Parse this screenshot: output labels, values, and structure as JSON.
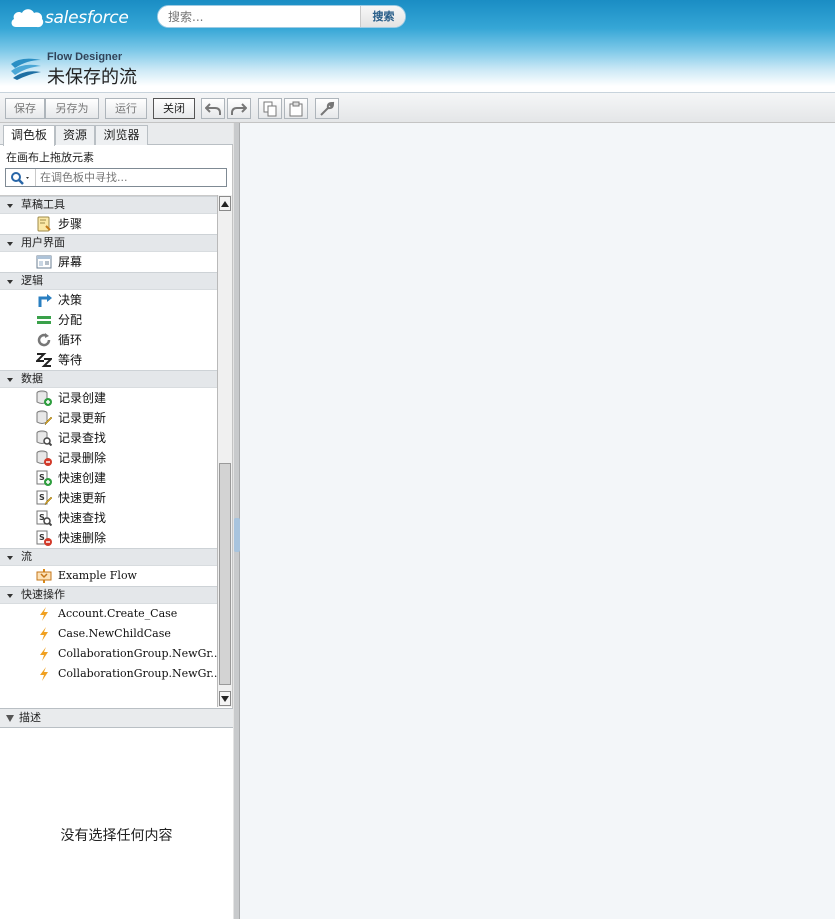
{
  "header": {
    "brand": "salesforce",
    "search_placeholder": "搜索...",
    "search_button": "搜索",
    "app_subtitle": "Flow Designer",
    "app_title": "未保存的流"
  },
  "toolbar": {
    "save": "保存",
    "save_as": "另存为",
    "run": "运行",
    "close": "关闭"
  },
  "left_panel": {
    "tabs": [
      "调色板",
      "资源",
      "浏览器"
    ],
    "hint": "在画布上拖放元素",
    "search_placeholder": "在调色板中寻找...",
    "sections": [
      {
        "title": "草稿工具",
        "items": [
          {
            "label": "步骤",
            "icon": "step-icon"
          }
        ]
      },
      {
        "title": "用户界面",
        "items": [
          {
            "label": "屏幕",
            "icon": "screen-icon"
          }
        ]
      },
      {
        "title": "逻辑",
        "items": [
          {
            "label": "决策",
            "icon": "decision-icon"
          },
          {
            "label": "分配",
            "icon": "assignment-icon"
          },
          {
            "label": "循环",
            "icon": "loop-icon"
          },
          {
            "label": "等待",
            "icon": "wait-icon"
          }
        ]
      },
      {
        "title": "数据",
        "items": [
          {
            "label": "记录创建",
            "icon": "record-create-icon"
          },
          {
            "label": "记录更新",
            "icon": "record-update-icon"
          },
          {
            "label": "记录查找",
            "icon": "record-lookup-icon"
          },
          {
            "label": "记录删除",
            "icon": "record-delete-icon"
          },
          {
            "label": "快速创建",
            "icon": "fast-create-icon"
          },
          {
            "label": "快速更新",
            "icon": "fast-update-icon"
          },
          {
            "label": "快速查找",
            "icon": "fast-lookup-icon"
          },
          {
            "label": "快速删除",
            "icon": "fast-delete-icon"
          }
        ]
      },
      {
        "title": "流",
        "items": [
          {
            "label": "Example Flow",
            "icon": "subflow-icon"
          }
        ]
      },
      {
        "title": "快速操作",
        "items": [
          {
            "label": "Account.Create_Case",
            "icon": "lightning-icon"
          },
          {
            "label": "Case.NewChildCase",
            "icon": "lightning-icon"
          },
          {
            "label": "CollaborationGroup.NewGr...",
            "icon": "lightning-icon"
          },
          {
            "label": "CollaborationGroup.NewGr...",
            "icon": "lightning-icon"
          }
        ]
      }
    ],
    "description_title": "描述",
    "description_empty": "没有选择任何内容"
  },
  "colors": {
    "header_blue": "#1a8dc4",
    "canvas_bg": "#f3f6f9",
    "section_bg": "#e4e7ea"
  }
}
